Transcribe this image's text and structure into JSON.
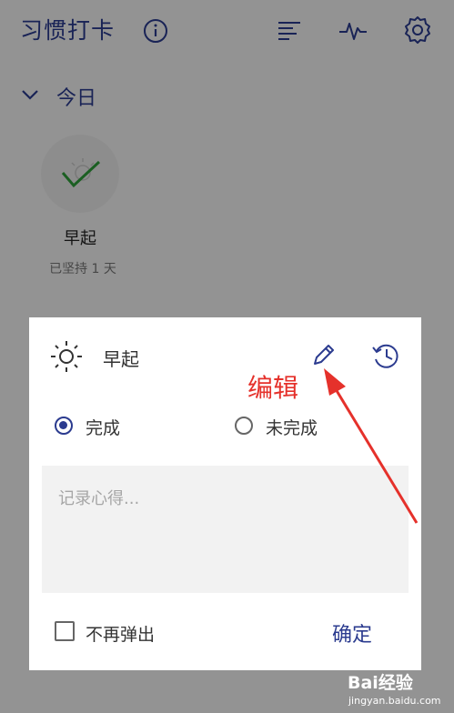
{
  "app": {
    "title": "习惯打卡"
  },
  "section": {
    "label": "今日"
  },
  "habit": {
    "name": "早起",
    "streak": "已坚持 1 天"
  },
  "dialog": {
    "title": "早起",
    "option_done": "完成",
    "option_not_done": "未完成",
    "selected": "完成",
    "note_placeholder": "记录心得...",
    "dont_show_label": "不再弹出",
    "dont_show_checked": false,
    "confirm_label": "确定"
  },
  "annotation": {
    "text": "编辑"
  },
  "watermark": {
    "brand": "Bai经验",
    "url": "jingyan.baidu.com"
  },
  "colors": {
    "accent": "#2b3b8f",
    "annotation": "#e5312b",
    "check": "#2e9e3a"
  },
  "icons": [
    "info-icon",
    "list-icon",
    "pulse-icon",
    "gear-icon",
    "chevron-down-icon",
    "sun-icon",
    "pencil-icon",
    "history-icon",
    "checkmark-icon"
  ]
}
